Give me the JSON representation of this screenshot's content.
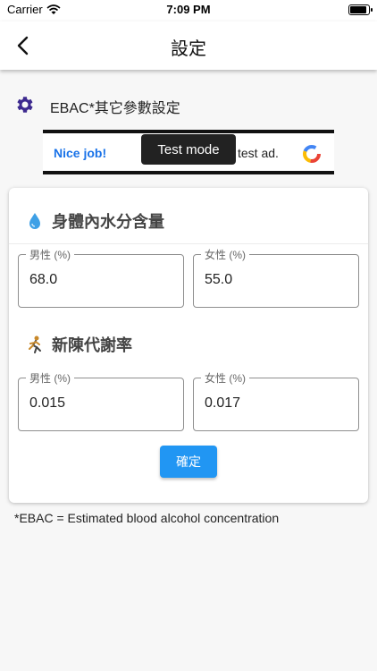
{
  "status_bar": {
    "carrier": "Carrier",
    "time": "7:09 PM",
    "battery_level": 0.9
  },
  "app_bar": {
    "back_icon": "chevron-left-icon",
    "title": "設定"
  },
  "section": {
    "icon": "gear-icon",
    "title": "EBAC*其它參數設定",
    "icon_color": "#3d2a8f"
  },
  "ad": {
    "left_text": "Nice job!",
    "right_text": "test ad.",
    "logo_icon": "admob-logo-icon",
    "toast": "Test mode"
  },
  "card": {
    "water": {
      "icon": "water-drop-icon",
      "title": "身體內水分含量",
      "male_label": "男性 (%)",
      "male_value": "68.0",
      "female_label": "女性 (%)",
      "female_value": "55.0"
    },
    "metabolism": {
      "icon": "runner-icon",
      "title": "新陳代謝率",
      "male_label": "男性 (%)",
      "male_value": "0.015",
      "female_label": "女性 (%)",
      "female_value": "0.017"
    },
    "confirm_label": "確定"
  },
  "footnote": "*EBAC = Estimated blood alcohol concentration",
  "colors": {
    "accent": "#2196f3",
    "ad_link": "#1a73e8"
  }
}
